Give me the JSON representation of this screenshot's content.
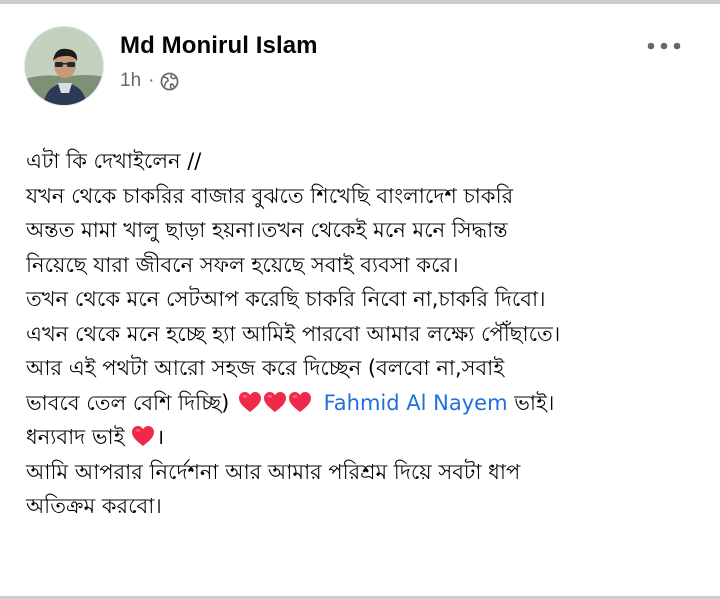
{
  "post": {
    "author": "Md Monirul Islam",
    "time": "1h",
    "separator": "·",
    "privacy_icon": "globe-icon",
    "more_icon": "more-options-icon",
    "lines": [
      "এটা কি দেখাইলেন //",
      "যখন থেকে চাকরির বাজার বুঝতে শিখেছি বাংলাদেশ চাকরি",
      "অন্তত মামা খালু ছাড়া হয়না।তখন থেকেই মনে মনে সিদ্ধান্ত",
      "নিয়েছে যারা জীবনে সফল হয়েছে সবাই ব্যবসা করে।",
      "তখন থেকে মনে সেটআপ করেছি চাকরি নিবো না,চাকরি দিবো।",
      "এখন থেকে মনে হচ্ছে হ্যা আমিই পারবো আমার লক্ষ্যে পৌঁছাতে।",
      "আর এই পথটা আরো সহজ করে দিচ্ছেন (বলবো না,সবাই"
    ],
    "line8_before": "ভাববে তেল বেশি দিচ্ছি)",
    "mention": "Fahmid Al Nayem",
    "line8_after": " ভাই।",
    "line9": "ধন্যবাদ ভাই ",
    "line9_after": "।",
    "line10": "আমি আপরার নির্দেশনা আর আমার পরিশ্রম দিয়ে  সবটা ধাপ",
    "line11": "অতিক্রম করবো।",
    "emoji": "heart-emoji",
    "heart_color": "#f02849",
    "mention_color": "#216fdb"
  }
}
